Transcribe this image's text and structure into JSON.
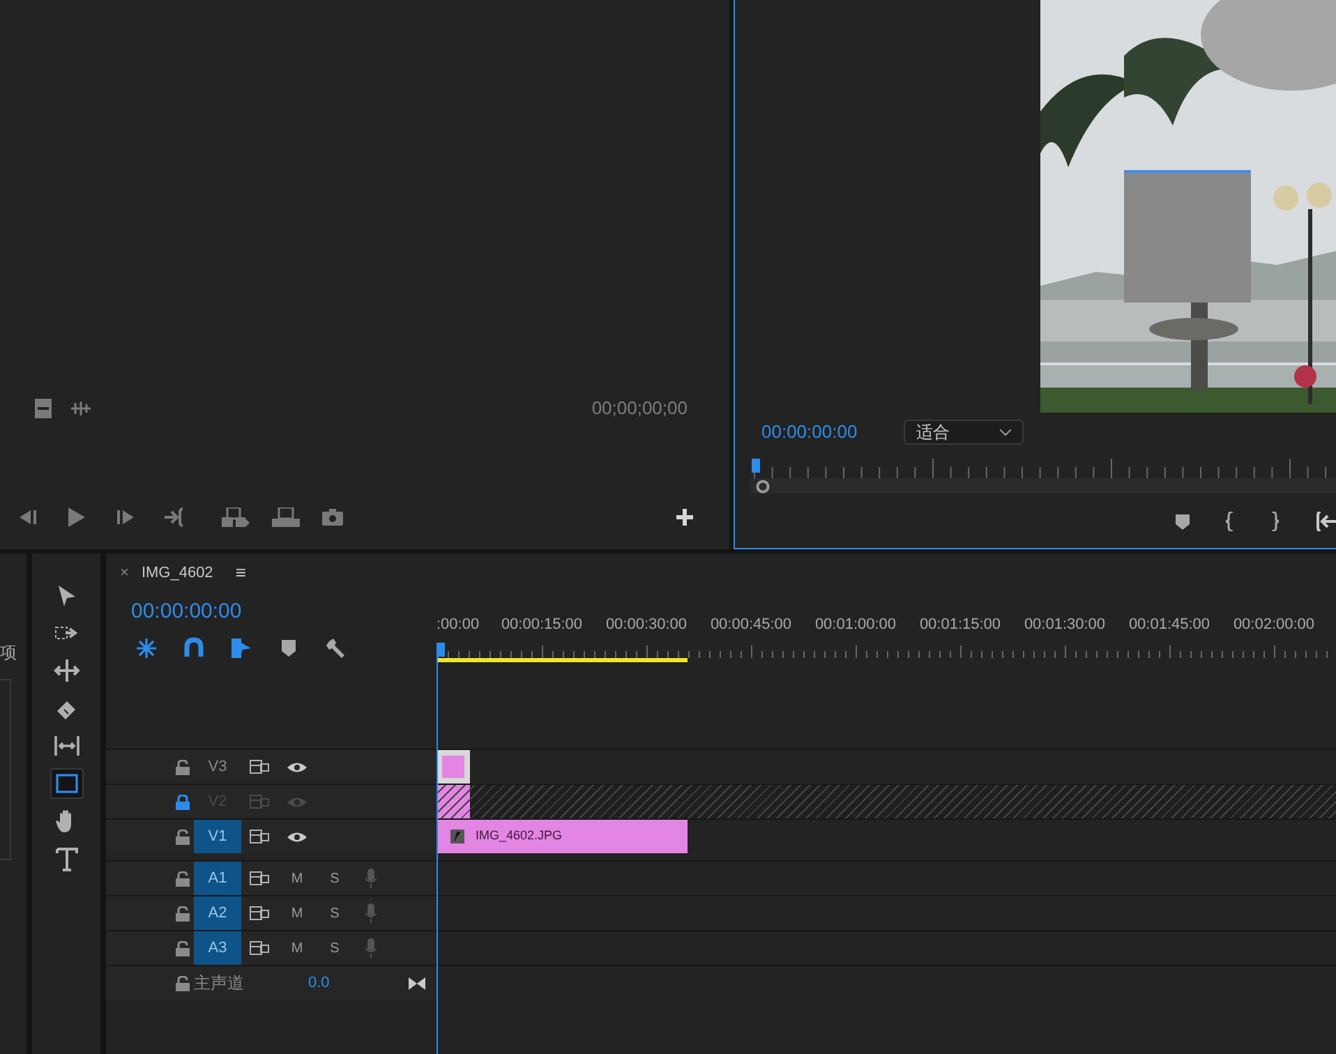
{
  "project_panel": {
    "label": "项"
  },
  "source_monitor": {
    "timecode": "00;00;00;00"
  },
  "program_monitor": {
    "timecode": "00:00:00:00",
    "zoom": "适合"
  },
  "tools": [
    {
      "kind": "selection",
      "selected": false
    },
    {
      "kind": "track-select",
      "selected": false
    },
    {
      "kind": "ripple",
      "selected": false
    },
    {
      "kind": "razor",
      "selected": false
    },
    {
      "kind": "slip",
      "selected": false
    },
    {
      "kind": "rectangle",
      "selected": true
    },
    {
      "kind": "hand",
      "selected": false
    },
    {
      "kind": "type",
      "selected": false
    }
  ],
  "timeline": {
    "close": "×",
    "tab": "IMG_4602",
    "menu": "≡",
    "timecode": "00:00:00:00",
    "toggles": [
      {
        "kind": "nest",
        "on": true
      },
      {
        "kind": "snap",
        "on": true
      },
      {
        "kind": "linked",
        "on": true
      },
      {
        "kind": "marker",
        "on": false
      },
      {
        "kind": "settings",
        "on": false
      }
    ],
    "ruler": [
      ":00:00",
      "00:00:15:00",
      "00:00:30:00",
      "00:00:45:00",
      "00:01:00:00",
      "00:01:15:00",
      "00:01:30:00",
      "00:01:45:00",
      "00:02:00:00"
    ],
    "tracks": [
      {
        "kind": "video",
        "name": "V3",
        "locked": false,
        "targeted": false,
        "clip": {
          "kind": "shape",
          "selected": true
        }
      },
      {
        "kind": "video",
        "name": "V2",
        "locked": true,
        "targeted": false
      },
      {
        "kind": "video",
        "name": "V1",
        "locked": false,
        "targeted": true,
        "clip": {
          "label": "IMG_4602.JPG"
        }
      },
      {
        "kind": "audio",
        "name": "A1",
        "locked": false,
        "targeted": true,
        "mute": "M",
        "solo": "S"
      },
      {
        "kind": "audio",
        "name": "A2",
        "locked": false,
        "targeted": true,
        "mute": "M",
        "solo": "S"
      },
      {
        "kind": "audio",
        "name": "A3",
        "locked": false,
        "targeted": true,
        "mute": "M",
        "solo": "S"
      },
      {
        "kind": "master",
        "name": "主声道",
        "volume": "0.0",
        "locked": false
      }
    ]
  }
}
